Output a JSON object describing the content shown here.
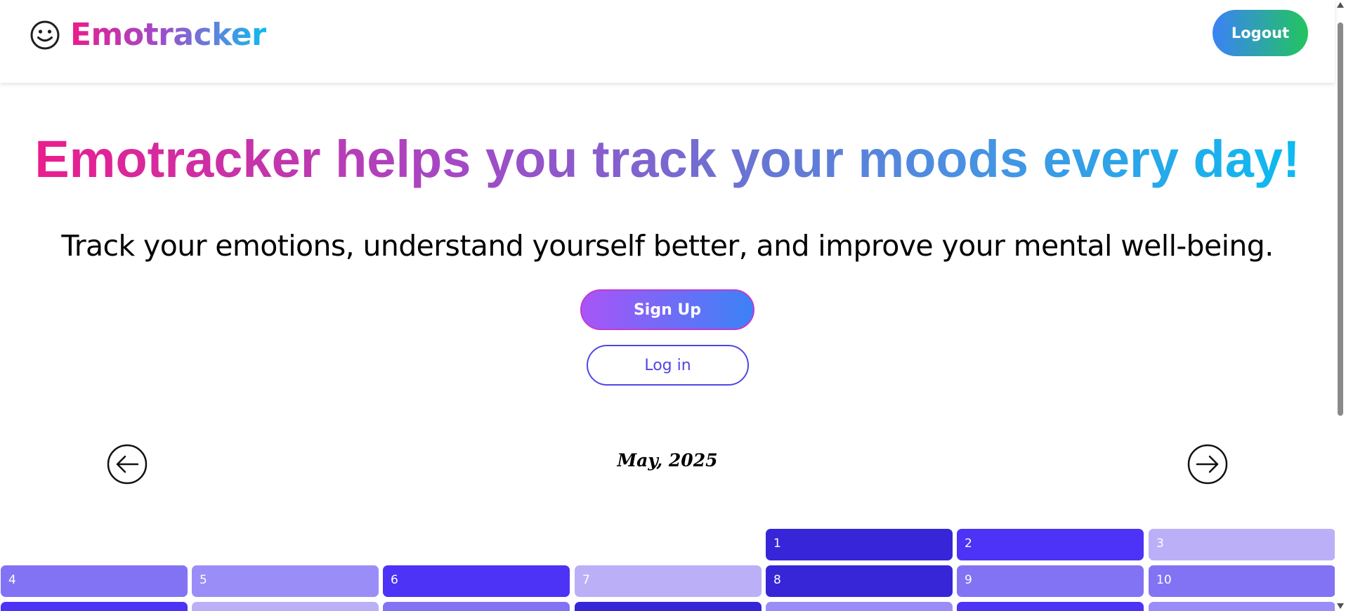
{
  "header": {
    "brand_name": "Emotracker",
    "logout_label": "Logout"
  },
  "hero": {
    "title": "Emotracker helps you track your moods every day!",
    "subtitle": "Track your emotions, understand yourself better, and improve your mental well-being.",
    "signup_label": "Sign Up",
    "login_label": "Log in"
  },
  "calendar": {
    "month_label": "May, 2025",
    "prev_icon": "arrow-left-circle-icon",
    "next_icon": "arrow-right-circle-icon",
    "days": [
      {
        "label": "1",
        "shade": "dark"
      },
      {
        "label": "2",
        "shade": "strong"
      },
      {
        "label": "3",
        "shade": "pale"
      },
      {
        "label": "4",
        "shade": "mid"
      },
      {
        "label": "5",
        "shade": "light"
      },
      {
        "label": "6",
        "shade": "strong"
      },
      {
        "label": "7",
        "shade": "pale"
      },
      {
        "label": "8",
        "shade": "dark"
      },
      {
        "label": "9",
        "shade": "mid"
      },
      {
        "label": "10",
        "shade": "mid"
      }
    ],
    "partial_row_shades": [
      "strong",
      "pale",
      "mid",
      "dark",
      "light",
      "strong",
      "light"
    ]
  },
  "colors": {
    "dark": "#3626d8",
    "strong": "#4c33f5",
    "mid": "#8273f5",
    "light": "#9b8df7",
    "pale": "#bbb0f8",
    "brand_pink": "#ec1c8c",
    "brand_cyan": "#0bbcf0"
  }
}
